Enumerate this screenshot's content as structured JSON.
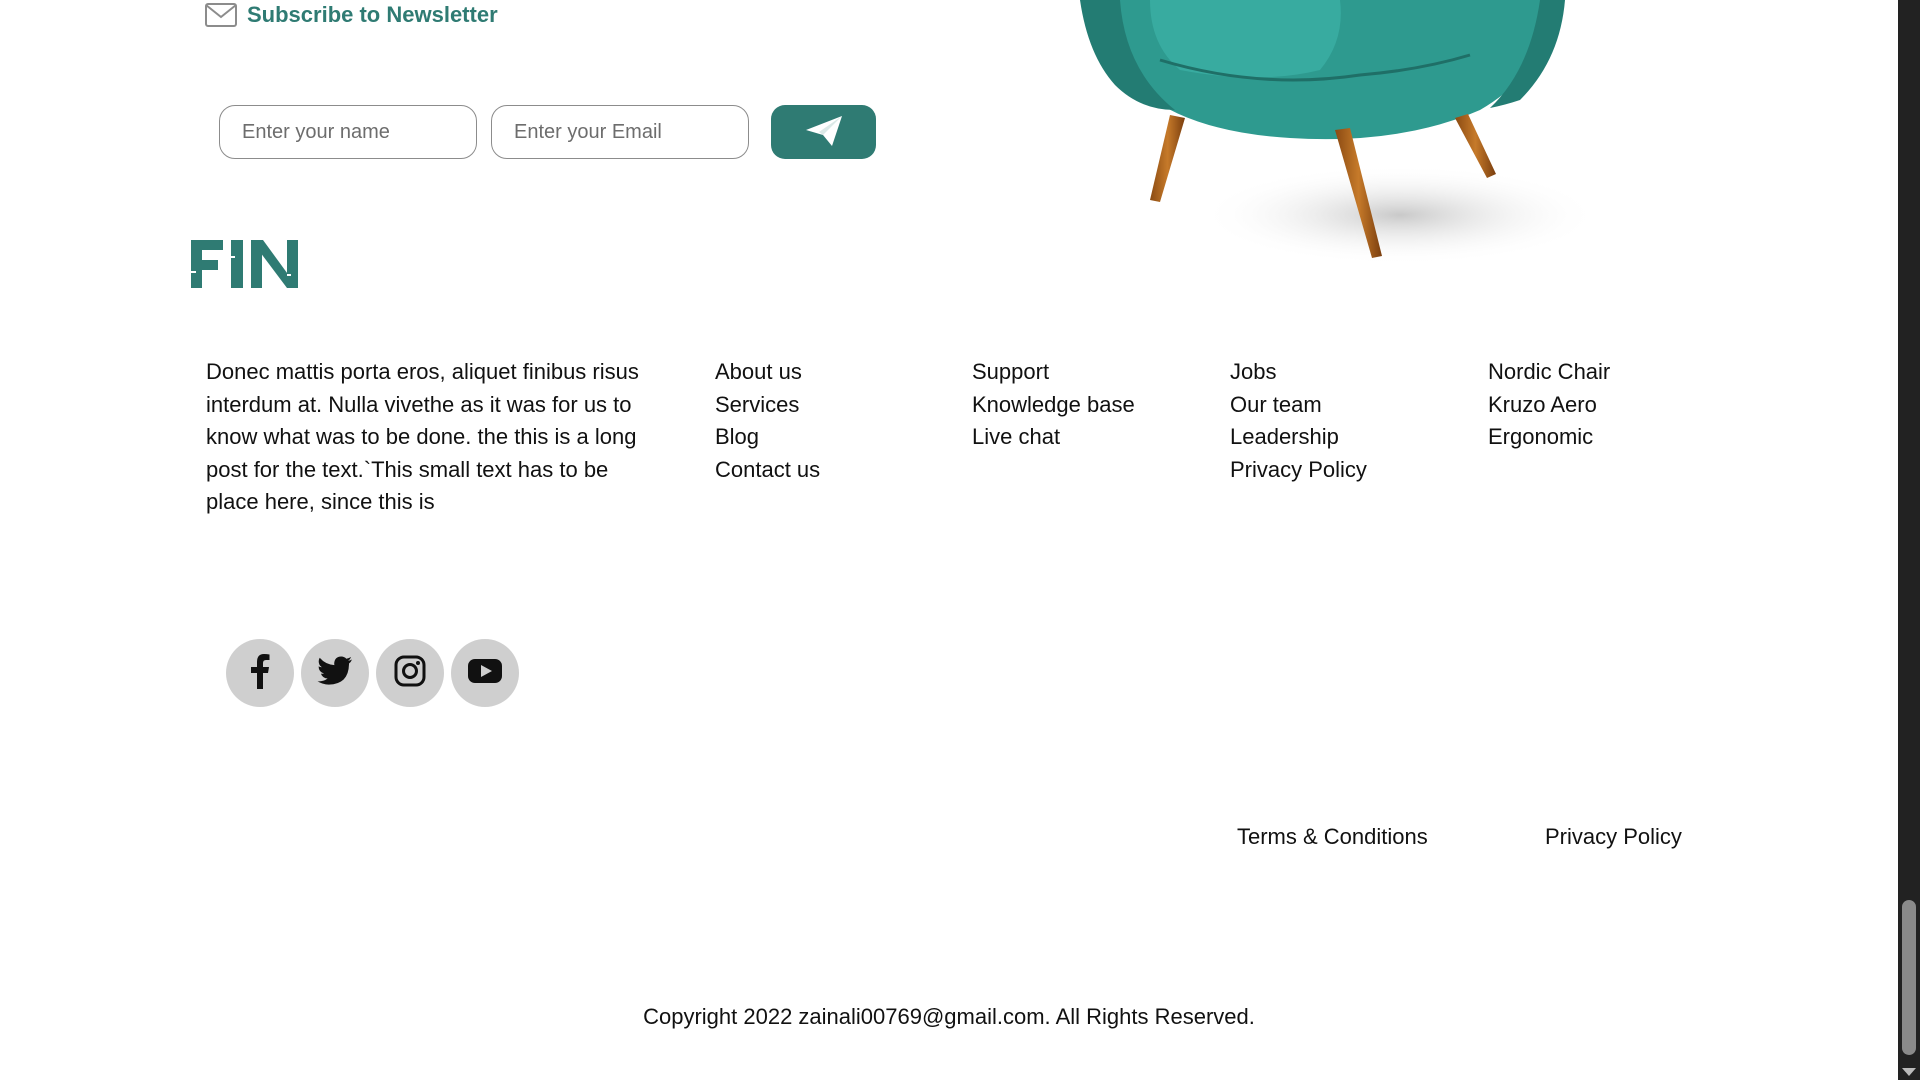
{
  "colors": {
    "accent": "#2f7b73",
    "social_bg": "#cfcfcf",
    "scrollbar": "#222222"
  },
  "newsletter": {
    "icon": "mail-icon",
    "label": "Subscribe to Newsletter",
    "name_placeholder": "Enter your name",
    "email_placeholder": "Enter your Email",
    "send_icon": "paper-plane-icon"
  },
  "logo": {
    "text": "FIN"
  },
  "footer": {
    "about": "Donec mattis porta eros, aliquet finibus risus interdum at. Nulla vivethe as it was for us to know what was to be done. the this is a long post for the text.`This small text has to be place here, since this is",
    "columns": [
      {
        "items": [
          "About us",
          "Services",
          "Blog",
          "Contact us"
        ]
      },
      {
        "items": [
          "Support",
          "Knowledge base",
          "Live chat"
        ]
      },
      {
        "items": [
          "Jobs",
          "Our team",
          "Leadership",
          "Privacy Policy"
        ]
      },
      {
        "items": [
          "Nordic Chair",
          "Kruzo Aero",
          "Ergonomic"
        ]
      }
    ],
    "social": [
      "facebook-icon",
      "twitter-icon",
      "instagram-icon",
      "youtube-icon"
    ],
    "legal": {
      "terms": "Terms & Conditions",
      "privacy": "Privacy Policy"
    },
    "copyright": "Copyright 2022 zainali00769@gmail.com. All Rights Reserved."
  }
}
